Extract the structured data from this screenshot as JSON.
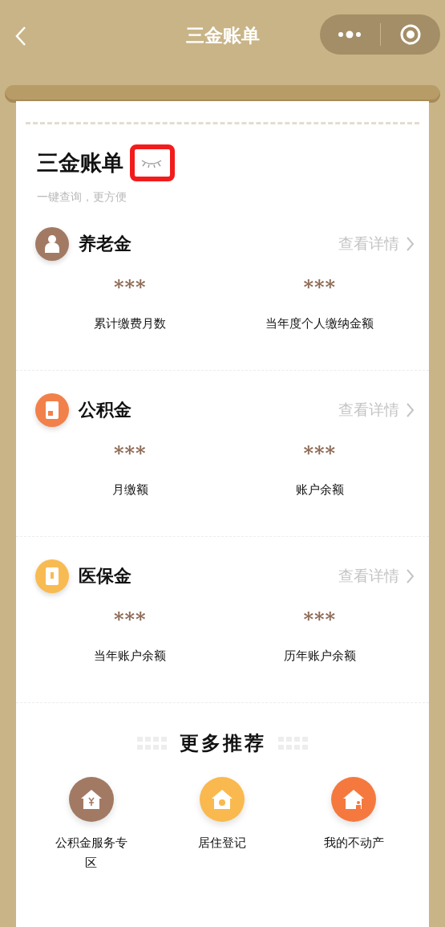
{
  "nav": {
    "title": "三金账单"
  },
  "header": {
    "title": "三金账单",
    "amounts_hidden": true,
    "subtitle": "一键查询，更方便"
  },
  "sections": [
    {
      "kind": "pension",
      "title": "养老金",
      "color": "#a27a64",
      "link": "查看详情",
      "fields": [
        {
          "value": "***",
          "label": "累计缴费月数"
        },
        {
          "value": "***",
          "label": "当年度个人缴纳金额"
        }
      ]
    },
    {
      "kind": "fund",
      "title": "公积金",
      "color": "#f2804a",
      "link": "查看详情",
      "fields": [
        {
          "value": "***",
          "label": "月缴额"
        },
        {
          "value": "***",
          "label": "账户余额"
        }
      ]
    },
    {
      "kind": "medical",
      "title": "医保金",
      "color": "#f8bb52",
      "link": "查看详情",
      "fields": [
        {
          "value": "***",
          "label": "当年账户余额"
        },
        {
          "value": "***",
          "label": "历年账户余额"
        }
      ]
    }
  ],
  "more": {
    "title": "更多推荐",
    "items": [
      {
        "kind": "money",
        "label": "公积金服务专区",
        "color": "#a27a64"
      },
      {
        "kind": "check",
        "label": "居住登记",
        "color": "#f9b94e"
      },
      {
        "kind": "person",
        "label": "我的不动产",
        "color": "#f5793f"
      }
    ]
  }
}
